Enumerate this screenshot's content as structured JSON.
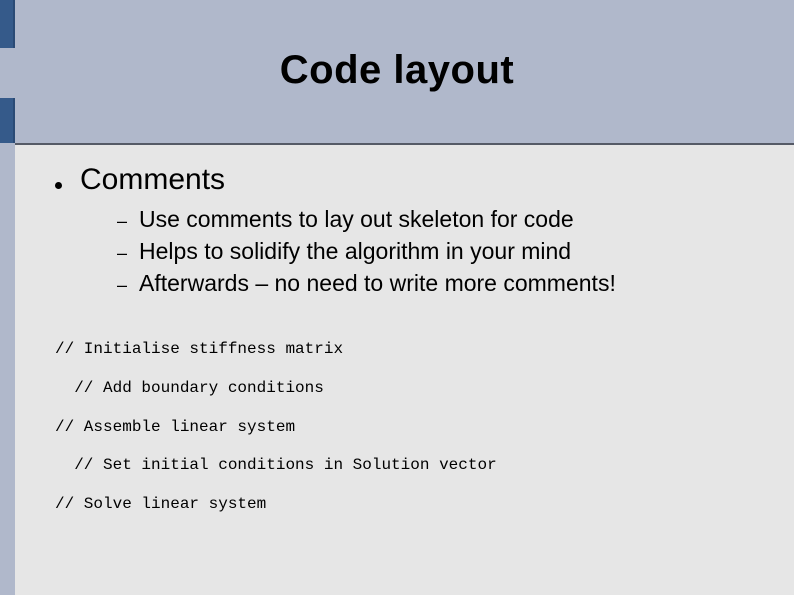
{
  "title": "Code layout",
  "bullet": {
    "label": "Comments",
    "subs": [
      "Use comments to lay out skeleton for code",
      "Helps to solidify the algorithm in your mind",
      "Afterwards – no need to write more comments!"
    ]
  },
  "code": {
    "l1": "// Initialise stiffness matrix",
    "l2": "  // Add boundary conditions",
    "l3": "// Assemble linear system",
    "l4": "  // Set initial conditions in Solution vector",
    "l5": "// Solve linear system"
  }
}
